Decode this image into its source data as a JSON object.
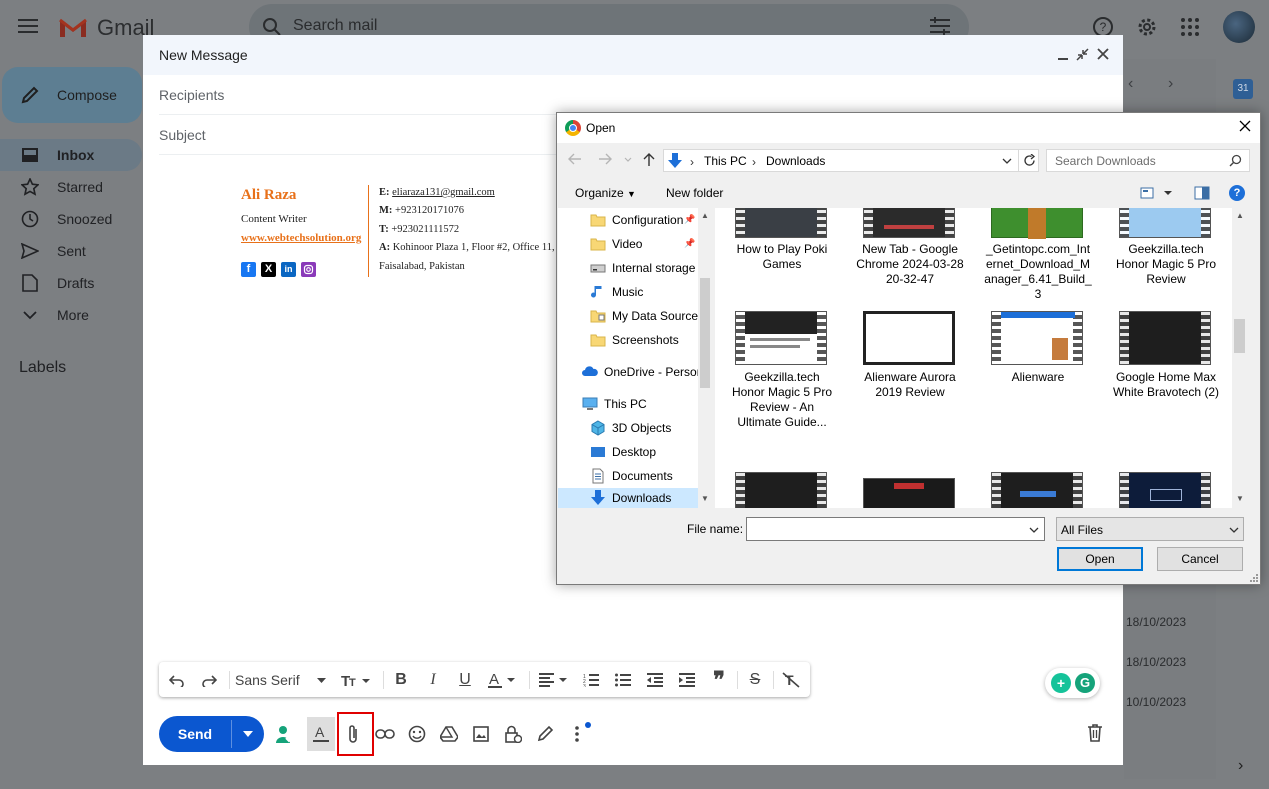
{
  "gmail": {
    "app_name": "Gmail",
    "search_placeholder": "Search mail",
    "compose_label": "Compose",
    "nav": [
      {
        "label": "Inbox"
      },
      {
        "label": "Starred"
      },
      {
        "label": "Snoozed"
      },
      {
        "label": "Sent"
      },
      {
        "label": "Drafts"
      },
      {
        "label": "More"
      }
    ],
    "labels_heading": "Labels",
    "dates": [
      "18/10/2023",
      "18/10/2023",
      "10/10/2023"
    ]
  },
  "compose": {
    "title": "New Message",
    "recipients_placeholder": "Recipients",
    "subject_placeholder": "Subject",
    "signature": {
      "name": "Ali Raza",
      "role": "Content Writer",
      "website": "www.webtechsolution.org",
      "email_label": "E:",
      "email": "eliaraza131@gmail.com",
      "mobile_label": "M:",
      "mobile": "+923120171076",
      "phone_label": "T:",
      "phone": "+923021111572",
      "address_label": "A:",
      "address_line1": "Kohinoor Plaza 1, Floor #2, Office 11,",
      "address_line2": "Faisalabad, Pakistan"
    },
    "font_name": "Sans Serif",
    "send_label": "Send",
    "brand_colors": {
      "send": "#0b57d0",
      "highlight": "#e00000",
      "name_orange": "#e8711a"
    }
  },
  "dialog": {
    "title": "Open",
    "breadcrumb": [
      "This PC",
      "Downloads"
    ],
    "search_placeholder": "Search Downloads",
    "organize_label": "Organize",
    "new_folder_label": "New folder",
    "tree": [
      {
        "label": "Configuration",
        "icon": "folder-icon",
        "pinned": true
      },
      {
        "label": "Video",
        "icon": "folder-icon",
        "pinned": true
      },
      {
        "label": "Internal storage",
        "icon": "drive-icon"
      },
      {
        "label": "Music",
        "icon": "music-icon"
      },
      {
        "label": "My Data Sources",
        "icon": "folder-icon"
      },
      {
        "label": "Screenshots",
        "icon": "folder-icon"
      },
      {
        "label": "OneDrive - Persor",
        "icon": "cloud-icon"
      },
      {
        "label": "This PC",
        "icon": "pc-icon"
      },
      {
        "label": "3D Objects",
        "icon": "cube-icon"
      },
      {
        "label": "Desktop",
        "icon": "desktop-icon"
      },
      {
        "label": "Documents",
        "icon": "document-icon"
      },
      {
        "label": "Downloads",
        "icon": "download-icon",
        "selected": true
      }
    ],
    "files_row1": [
      {
        "label": "How to Play Poki Games"
      },
      {
        "label": "New Tab - Google Chrome 2024-03-28 20-32-47"
      },
      {
        "label": "_Getintopc.com_Internet_Download_Manager_6.41_Build_3"
      },
      {
        "label": "Geekzilla.tech Honor Magic 5 Pro Review"
      }
    ],
    "files_row2": [
      {
        "label": "Geekzilla.tech Honor Magic 5 Pro Review - An Ultimate Guide..."
      },
      {
        "label": "Alienware Aurora 2019 Review"
      },
      {
        "label": "Alienware"
      },
      {
        "label": "Google Home Max White Bravotech (2)"
      }
    ],
    "filename_label": "File name:",
    "filename_value": "",
    "filetype": "All Files",
    "open_label": "Open",
    "cancel_label": "Cancel"
  }
}
